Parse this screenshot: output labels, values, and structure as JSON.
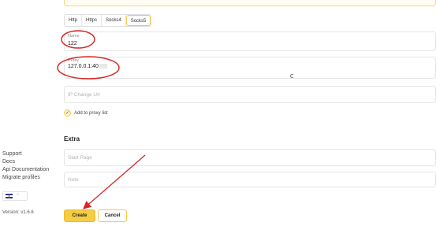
{
  "sidebar": {
    "links": [
      "Support",
      "Docs",
      "Api Documentation",
      "Migrate profiles"
    ],
    "language": "English",
    "version": "Version: v1.6.6"
  },
  "proxy_types": {
    "items": [
      "Http",
      "Https",
      "Socks4",
      "Socks5"
    ],
    "selected": "Socks5"
  },
  "form": {
    "name": {
      "label": "Name",
      "value": "122"
    },
    "proxy": {
      "label": "Proxy",
      "value": "127.0.0.1:40"
    },
    "ip_change_url": {
      "placeholder": "IP Change Url"
    },
    "add_to_list": {
      "label": "Add to proxy list",
      "checked": true
    }
  },
  "extra": {
    "title": "Extra",
    "start_page": {
      "placeholder": "Start Page"
    },
    "note": {
      "placeholder": "Note"
    }
  },
  "buttons": {
    "create": "Create",
    "cancel": "Cancel"
  },
  "annotation_color": "#d62828",
  "accent_color": "#f4cd43"
}
